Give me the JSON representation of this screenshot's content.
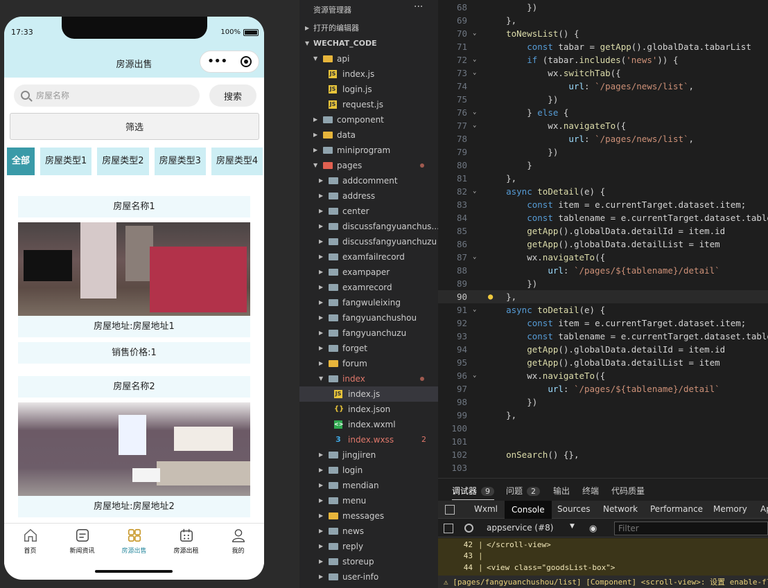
{
  "simulator": {
    "status_time": "17:33",
    "battery": "100%",
    "nav_title": "房源出售",
    "search_placeholder": "房屋名称",
    "search_button": "搜索",
    "filter_button": "筛选",
    "categories": [
      "全部",
      "房屋类型1",
      "房屋类型2",
      "房屋类型3",
      "房屋类型4"
    ],
    "listings": [
      {
        "name": "房屋名称1",
        "address": "房屋地址:房屋地址1",
        "price": "销售价格:1"
      },
      {
        "name": "房屋名称2",
        "address": "房屋地址:房屋地址2"
      }
    ],
    "tabbar": [
      {
        "label": "首页",
        "icon": "home-icon"
      },
      {
        "label": "新闻资讯",
        "icon": "news-icon"
      },
      {
        "label": "房源出售",
        "icon": "grid-icon"
      },
      {
        "label": "房源出租",
        "icon": "calendar-icon"
      },
      {
        "label": "我的",
        "icon": "user-icon"
      }
    ],
    "colors": {
      "accent": "#3a9aa8",
      "nav_bg": "#cdeef4",
      "active_tab": "#2d8ba0"
    }
  },
  "explorer": {
    "title": "资源管理器",
    "more": "···",
    "open_editors": "打开的编辑器",
    "root": "WECHAT_CODE",
    "rows": [
      {
        "label": "api",
        "type": "folder-open",
        "color": "yellow",
        "depth": 1
      },
      {
        "label": "index.js",
        "type": "js",
        "depth": 2
      },
      {
        "label": "login.js",
        "type": "js",
        "depth": 2
      },
      {
        "label": "request.js",
        "type": "js",
        "depth": 2
      },
      {
        "label": "component",
        "type": "folder",
        "depth": 1
      },
      {
        "label": "data",
        "type": "folder",
        "color": "yellow",
        "depth": 1
      },
      {
        "label": "miniprogram",
        "type": "folder",
        "depth": 1
      },
      {
        "label": "pages",
        "type": "folder-open",
        "color": "red",
        "depth": 1,
        "dot": true
      },
      {
        "label": "addcomment",
        "type": "folder",
        "depth": 2
      },
      {
        "label": "address",
        "type": "folder",
        "depth": 2
      },
      {
        "label": "center",
        "type": "folder",
        "depth": 2
      },
      {
        "label": "discussfangyuanchus...",
        "type": "folder",
        "depth": 2
      },
      {
        "label": "discussfangyuanchuzu",
        "type": "folder",
        "depth": 2
      },
      {
        "label": "examfailrecord",
        "type": "folder",
        "depth": 2
      },
      {
        "label": "exampaper",
        "type": "folder",
        "depth": 2
      },
      {
        "label": "examrecord",
        "type": "folder",
        "depth": 2
      },
      {
        "label": "fangwuleixing",
        "type": "folder",
        "depth": 2
      },
      {
        "label": "fangyuanchushou",
        "type": "folder",
        "depth": 2
      },
      {
        "label": "fangyuanchuzu",
        "type": "folder",
        "depth": 2
      },
      {
        "label": "forget",
        "type": "folder",
        "depth": 2
      },
      {
        "label": "forum",
        "type": "folder",
        "color": "yellow",
        "depth": 2
      },
      {
        "label": "index",
        "type": "folder-open",
        "depth": 2,
        "dot": true,
        "red": true
      },
      {
        "label": "index.js",
        "type": "js",
        "depth": 3,
        "selected": true
      },
      {
        "label": "index.json",
        "type": "json",
        "depth": 3
      },
      {
        "label": "index.wxml",
        "type": "wxml",
        "depth": 3
      },
      {
        "label": "index.wxss",
        "type": "wxss",
        "depth": 3,
        "red": true,
        "badge": "2"
      },
      {
        "label": "jingjiren",
        "type": "folder",
        "depth": 2
      },
      {
        "label": "login",
        "type": "folder",
        "depth": 2
      },
      {
        "label": "mendian",
        "type": "folder",
        "depth": 2
      },
      {
        "label": "menu",
        "type": "folder",
        "depth": 2
      },
      {
        "label": "messages",
        "type": "folder",
        "color": "yellow",
        "depth": 2
      },
      {
        "label": "news",
        "type": "folder",
        "depth": 2
      },
      {
        "label": "reply",
        "type": "folder",
        "depth": 2
      },
      {
        "label": "storeup",
        "type": "folder",
        "depth": 2
      },
      {
        "label": "user-info",
        "type": "folder",
        "depth": 2
      }
    ]
  },
  "editor": {
    "current_line": 90,
    "lines": [
      {
        "n": 68,
        "t": "        })"
      },
      {
        "n": 69,
        "t": "    },"
      },
      {
        "n": 70,
        "t": "    toNewsList() {",
        "fold": true
      },
      {
        "n": 71,
        "t": "        const tabar = getApp().globalData.tabarList"
      },
      {
        "n": 72,
        "t": "        if (tabar.includes('news')) {",
        "fold": true
      },
      {
        "n": 73,
        "t": "            wx.switchTab({",
        "fold": true
      },
      {
        "n": 74,
        "t": "                url: `/pages/news/list`,"
      },
      {
        "n": 75,
        "t": "            })"
      },
      {
        "n": 76,
        "t": "        } else {",
        "fold": true
      },
      {
        "n": 77,
        "t": "            wx.navigateTo({",
        "fold": true
      },
      {
        "n": 78,
        "t": "                url: `/pages/news/list`,"
      },
      {
        "n": 79,
        "t": "            })"
      },
      {
        "n": 80,
        "t": "        }"
      },
      {
        "n": 81,
        "t": "    },"
      },
      {
        "n": 82,
        "t": "    async toDetail(e) {",
        "fold": true
      },
      {
        "n": 83,
        "t": "        const item = e.currentTarget.dataset.item;"
      },
      {
        "n": 84,
        "t": "        const tablename = e.currentTarget.dataset.tablename"
      },
      {
        "n": 85,
        "t": "        getApp().globalData.detailId = item.id"
      },
      {
        "n": 86,
        "t": "        getApp().globalData.detailList = item"
      },
      {
        "n": 87,
        "t": "        wx.navigateTo({",
        "fold": true
      },
      {
        "n": 88,
        "t": "            url: `/pages/${tablename}/detail`"
      },
      {
        "n": 89,
        "t": "        })"
      },
      {
        "n": 90,
        "t": "    },"
      },
      {
        "n": 91,
        "t": "    async toDetail(e) {",
        "fold": true
      },
      {
        "n": 92,
        "t": "        const item = e.currentTarget.dataset.item;"
      },
      {
        "n": 93,
        "t": "        const tablename = e.currentTarget.dataset.tablename"
      },
      {
        "n": 94,
        "t": "        getApp().globalData.detailId = item.id"
      },
      {
        "n": 95,
        "t": "        getApp().globalData.detailList = item"
      },
      {
        "n": 96,
        "t": "        wx.navigateTo({",
        "fold": true
      },
      {
        "n": 97,
        "t": "            url: `/pages/${tablename}/detail`"
      },
      {
        "n": 98,
        "t": "        })"
      },
      {
        "n": 99,
        "t": "    },"
      },
      {
        "n": 100,
        "t": ""
      },
      {
        "n": 101,
        "t": ""
      },
      {
        "n": 102,
        "t": "    onSearch() {},"
      },
      {
        "n": 103,
        "t": ""
      }
    ]
  },
  "panel": {
    "tabs": [
      {
        "label": "调试器",
        "badge": "9",
        "active": true
      },
      {
        "label": "问题",
        "badge": "2"
      },
      {
        "label": "输出"
      },
      {
        "label": "终端"
      },
      {
        "label": "代码质量"
      }
    ],
    "devtools_tabs": [
      "Wxml",
      "Console",
      "Sources",
      "Network",
      "Performance",
      "Memory",
      "AppData"
    ],
    "devtools_active": "Console",
    "context": "appservice (#8)",
    "filter_placeholder": "Filter",
    "console_lines": [
      {
        "n": "42",
        "t": "</scroll-view>"
      },
      {
        "n": "43",
        "t": ""
      },
      {
        "n": "44",
        "t": "<view class=\"goodsList-box\">"
      }
    ],
    "warning": "⚠ [pages/fangyuanchushou/list] [Component] <scroll-view>: 设置 enable-flex"
  }
}
